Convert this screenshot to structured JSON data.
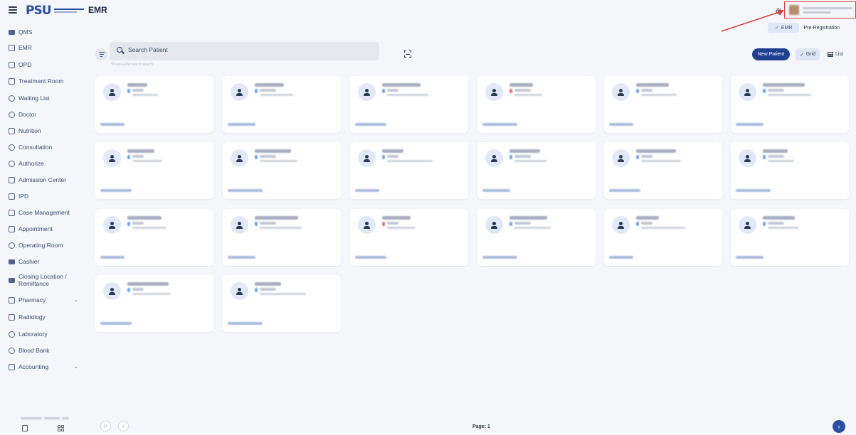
{
  "header": {
    "app_title": "EMR",
    "logo_text": "PSU",
    "settings_icon": "gear-icon",
    "menu_icon": "hamburger-icon"
  },
  "mode_toggle": {
    "emr_label": "EMR",
    "preregistration_label": "Pre-Registration",
    "selected": "EMR"
  },
  "sidebar": {
    "items": [
      {
        "label": "QMS",
        "icon": "users-icon",
        "expandable": false
      },
      {
        "label": "EMR",
        "icon": "records-icon",
        "expandable": false
      },
      {
        "label": "OPD",
        "icon": "opd-icon",
        "expandable": false
      },
      {
        "label": "Treatment Room",
        "icon": "treatment-icon",
        "expandable": false
      },
      {
        "label": "Waiting List",
        "icon": "walking-icon",
        "expandable": false
      },
      {
        "label": "Doctor",
        "icon": "stethoscope-icon",
        "expandable": false
      },
      {
        "label": "Nutrition",
        "icon": "utensils-icon",
        "expandable": false
      },
      {
        "label": "Consultation",
        "icon": "consultation-icon",
        "expandable": false
      },
      {
        "label": "Authorize",
        "icon": "check-circle-icon",
        "expandable": false
      },
      {
        "label": "Admission Center",
        "icon": "admission-icon",
        "expandable": false
      },
      {
        "label": "IPD",
        "icon": "ipd-icon",
        "expandable": false
      },
      {
        "label": "Case Management",
        "icon": "case-icon",
        "expandable": false
      },
      {
        "label": "Appointment",
        "icon": "calendar-icon",
        "expandable": false
      },
      {
        "label": "Operating Room",
        "icon": "scalpel-icon",
        "expandable": false
      },
      {
        "label": "Cashier",
        "icon": "cash-register-icon",
        "expandable": false
      },
      {
        "label": "Closing Location / Remittance",
        "icon": "money-icon",
        "expandable": false
      },
      {
        "label": "Pharmacy",
        "icon": "pill-bottle-icon",
        "expandable": true
      },
      {
        "label": "Radiology",
        "icon": "radiology-icon",
        "expandable": false
      },
      {
        "label": "Laboratory",
        "icon": "flask-icon",
        "expandable": false
      },
      {
        "label": "Blood Bank",
        "icon": "blood-icon",
        "expandable": false
      },
      {
        "label": "Accounting",
        "icon": "accounting-icon",
        "expandable": true
      }
    ],
    "chevron_glyph": "⌄"
  },
  "search": {
    "placeholder": "Search Patient",
    "value": "",
    "hint": "*Press Enter key to search"
  },
  "toolbar": {
    "new_patient_label": "New Patient",
    "grid_label": "Grid",
    "list_label": "List",
    "active_view": "Grid",
    "check_glyph": "✓"
  },
  "patients": {
    "count": 20,
    "status_colors": {
      "male": "#6aa6e8",
      "female": "#e86a7c"
    },
    "note": ""
  },
  "pagination": {
    "page_label": "Page: 1",
    "first_glyph": "|‹",
    "prev_glyph": "‹",
    "next_glyph": "›"
  },
  "colors": {
    "brand": "#2a4fa2",
    "primary_button": "#1f3f8f",
    "highlight_box": "#d94040"
  }
}
